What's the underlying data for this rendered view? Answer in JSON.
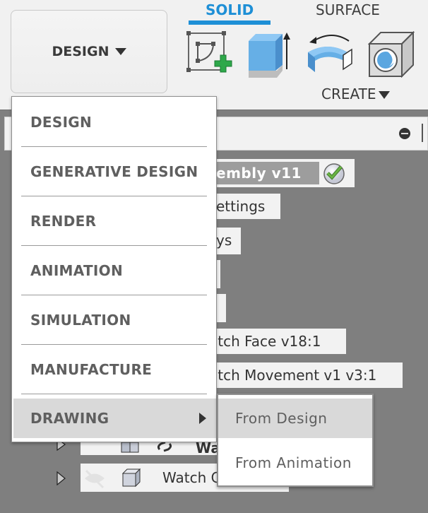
{
  "toolbar": {
    "workspace_label": "DESIGN",
    "tabs": [
      {
        "label": "SOLID",
        "active": true
      },
      {
        "label": "SURFACE",
        "active": false
      }
    ],
    "tools": [
      {
        "name": "create-sketch",
        "icon": "sketch-plus-icon"
      },
      {
        "name": "extrude",
        "icon": "extrude-icon"
      },
      {
        "name": "revolve",
        "icon": "revolve-icon"
      },
      {
        "name": "hole",
        "icon": "hole-icon"
      }
    ],
    "create_label": "CREATE",
    "accent_color": "#1e8fd6"
  },
  "browser": {
    "items": [
      {
        "label": "embly v11",
        "status": "check-icon"
      },
      {
        "label": "ettings"
      },
      {
        "label": "ys"
      },
      {
        "label": ""
      },
      {
        "label": ""
      },
      {
        "label": "atch Face v18:1"
      },
      {
        "label": "atch Movement v1 v3:1"
      },
      {
        "label": "Wa"
      },
      {
        "label": "Watch C"
      }
    ]
  },
  "workspace_menu": {
    "items": [
      {
        "label": "DESIGN"
      },
      {
        "label": "GENERATIVE DESIGN"
      },
      {
        "label": "RENDER"
      },
      {
        "label": "ANIMATION"
      },
      {
        "label": "SIMULATION"
      },
      {
        "label": "MANUFACTURE"
      },
      {
        "label": "DRAWING",
        "has_submenu": true,
        "highlighted": true
      }
    ],
    "submenu": {
      "items": [
        {
          "label": "From Design",
          "highlighted": true
        },
        {
          "label": "From Animation"
        }
      ]
    }
  }
}
